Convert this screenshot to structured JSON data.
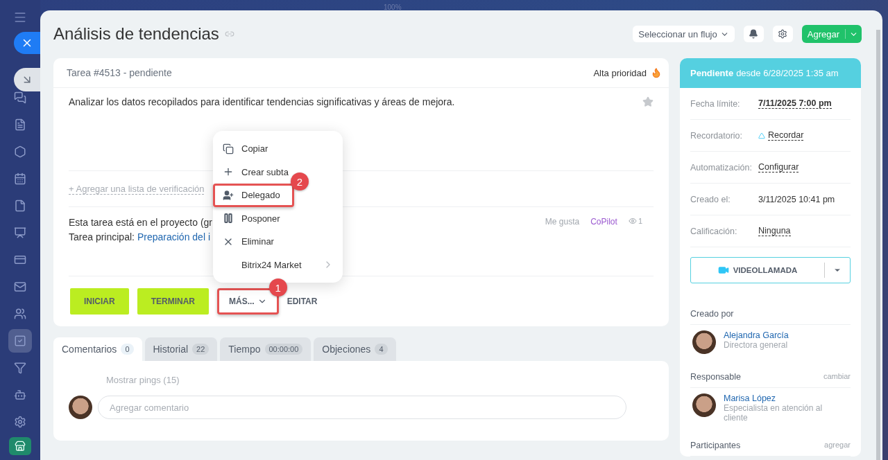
{
  "zoom_label": "100%",
  "sidebar": {
    "items": [
      {
        "selected": false
      },
      {
        "selected": false
      },
      {
        "selected": false
      },
      {
        "selected": false
      },
      {
        "selected": false
      },
      {
        "selected": false
      },
      {
        "selected": false
      },
      {
        "selected": false
      },
      {
        "selected": false
      },
      {
        "selected": true
      },
      {
        "selected": false
      },
      {
        "selected": false
      },
      {
        "selected": false
      }
    ]
  },
  "header": {
    "title": "Análisis de tendencias",
    "flow_select": "Seleccionar un flujo",
    "add_button": "Agregar"
  },
  "task": {
    "number": "Tarea #4513 - pendiente",
    "priority": "Alta prioridad",
    "high_priority": true,
    "starred": false,
    "description": "Analizar los datos recopilados para identificar tendencias significativas y áreas de mejora.",
    "checklist_link": "+ Agregar una lista de verificación",
    "project_text": "Esta tarea está en el proyecto (gr",
    "parent_label": "Tarea principal:",
    "parent_link": "Preparación del i",
    "like": "Me gusta",
    "copilot": "CoPilot",
    "views": "1",
    "buttons": [
      {
        "kind": "primary",
        "label": "INICIAR"
      },
      {
        "kind": "primary",
        "label": "TERMINAR"
      },
      {
        "kind": "more",
        "label": "MÁS...",
        "callout": "1"
      },
      {
        "kind": "plain",
        "label": "EDITAR"
      }
    ]
  },
  "menu": {
    "items": [
      {
        "kind": "copy",
        "label": "Copiar",
        "highlighted": false
      },
      {
        "kind": "plus",
        "label": "Crear subta",
        "highlighted": false
      },
      {
        "kind": "delegate",
        "label": "Delegado",
        "highlighted": true,
        "callout": "2"
      },
      {
        "kind": "pause",
        "label": "Posponer",
        "highlighted": false
      },
      {
        "kind": "delete",
        "label": "Eliminar",
        "highlighted": false
      },
      {
        "kind": "submenu",
        "label": "Bitrix24 Market",
        "highlighted": false
      }
    ]
  },
  "tabs": [
    {
      "label": "Comentarios",
      "count": "0",
      "selected": true
    },
    {
      "label": "Historial",
      "count": "22",
      "selected": false
    },
    {
      "label": "Tiempo",
      "count": "00:00:00",
      "selected": false
    },
    {
      "label": "Objeciones",
      "count": "4",
      "selected": false
    }
  ],
  "comments": {
    "pings": "Mostrar pings (15)",
    "placeholder": "Agregar comentario"
  },
  "status": {
    "state": "Pendiente",
    "since": "desde 6/28/2025 1:35 am"
  },
  "fields": [
    {
      "label": "Fecha límite:",
      "value": "7/11/2025 7:00 pm",
      "kind": "bold_link"
    },
    {
      "label": "Recordatorio:",
      "value": "Recordar",
      "kind": "bell_link"
    },
    {
      "label": "Automatización:",
      "value": "Configurar",
      "kind": "link"
    },
    {
      "label": "Creado el:",
      "value": "3/11/2025 10:41 pm",
      "kind": "text"
    },
    {
      "label": "Calificación:",
      "value": "Ninguna",
      "kind": "link"
    }
  ],
  "video_call": "VIDEOLLAMADA",
  "people": [
    {
      "heading": "Creado por",
      "name": "Alejandra García",
      "role": "Directora general"
    },
    {
      "heading": "Responsable",
      "action": "cambiar",
      "name": "Marisa López",
      "role": "Especialista en atención al cliente"
    },
    {
      "heading": "Participantes",
      "action": "agregar"
    }
  ]
}
